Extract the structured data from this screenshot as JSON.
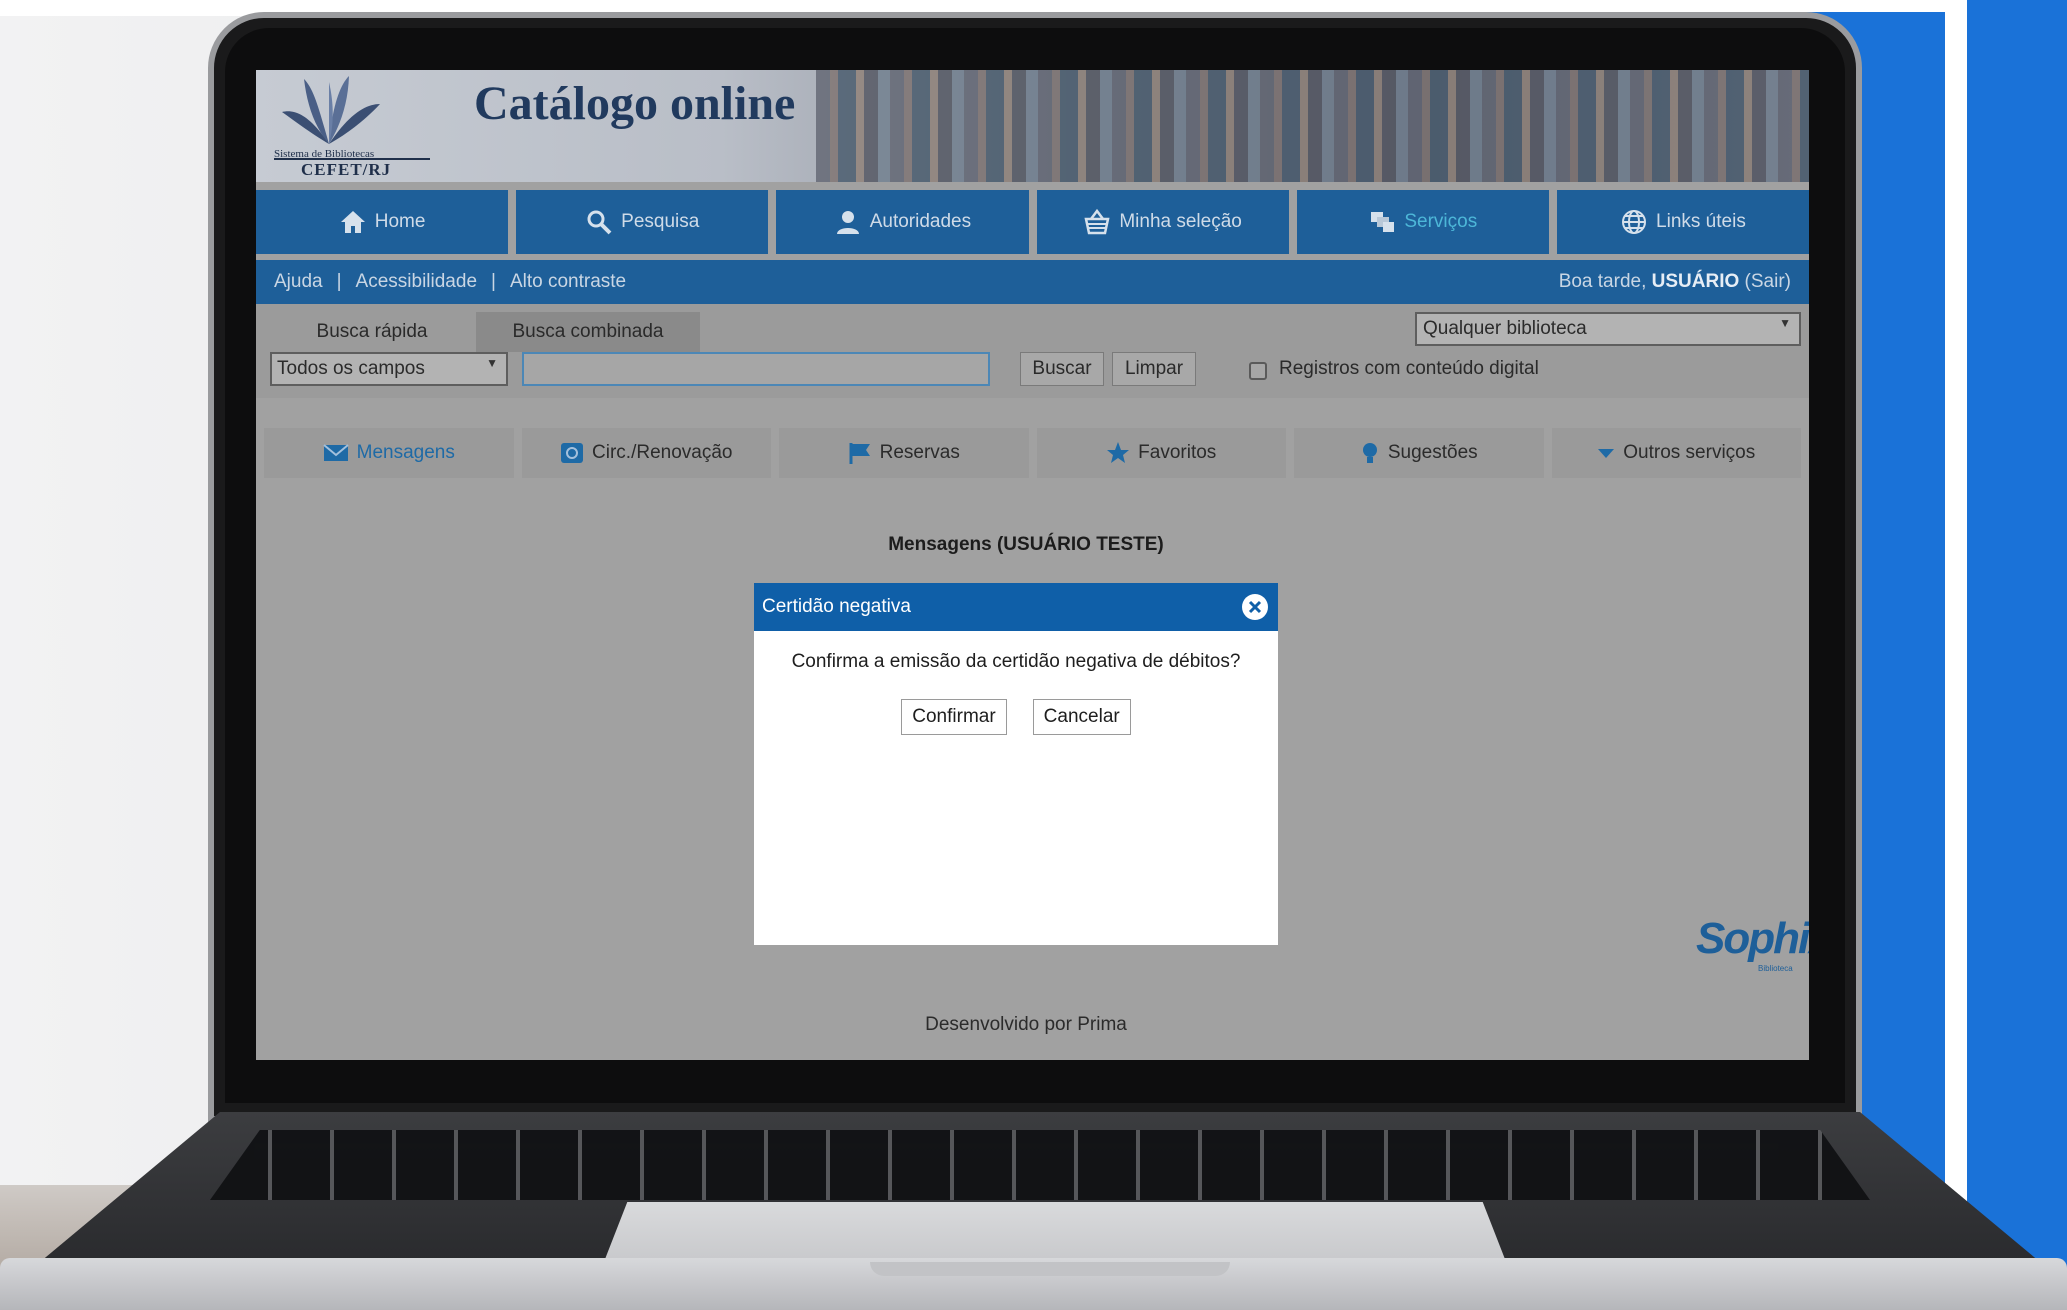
{
  "site": {
    "title": "Catálogo online",
    "logo_line1": "Sistema de Bibliotecas",
    "logo_line2": "CEFET/RJ"
  },
  "nav": [
    {
      "label": "Home",
      "icon": "home-icon"
    },
    {
      "label": "Pesquisa",
      "icon": "search-icon"
    },
    {
      "label": "Autoridades",
      "icon": "person-icon"
    },
    {
      "label": "Minha seleção",
      "icon": "basket-icon"
    },
    {
      "label": "Serviços",
      "icon": "services-icon",
      "active": true
    },
    {
      "label": "Links úteis",
      "icon": "globe-icon"
    }
  ],
  "subbar": {
    "help": "Ajuda",
    "accessibility": "Acessibilidade",
    "contrast": "Alto contraste",
    "greeting": "Boa tarde,",
    "user": "USUÁRIO",
    "logout": "(Sair)"
  },
  "search": {
    "tab_quick": "Busca rápida",
    "tab_combined": "Busca combinada",
    "library_select": "Qualquer biblioteca",
    "field_select": "Todos os campos",
    "input_value": "",
    "search_button": "Buscar",
    "clear_button": "Limpar",
    "digital_checkbox_label": "Registros com conteúdo digital",
    "digital_checked": false
  },
  "services": [
    {
      "label": "Mensagens",
      "icon": "envelope-icon",
      "active": true
    },
    {
      "label": "Circ./Renovação",
      "icon": "renew-icon"
    },
    {
      "label": "Reservas",
      "icon": "flag-icon"
    },
    {
      "label": "Favoritos",
      "icon": "star-icon"
    },
    {
      "label": "Sugestões",
      "icon": "lightbulb-icon"
    },
    {
      "label": "Outros serviços",
      "icon": "caret-down-icon"
    }
  ],
  "messages_title": "Mensagens (USUÁRIO TESTE)",
  "modal": {
    "title": "Certidão negativa",
    "text": "Confirma a emissão da certidão negativa de débitos?",
    "confirm": "Confirmar",
    "cancel": "Cancelar"
  },
  "brand": {
    "name": "SophiA",
    "sub": "Biblioteca"
  },
  "footer": "Desenvolvido por Prima",
  "colors": {
    "nav_blue": "#1e5f99",
    "modal_header": "#0f5fa8",
    "background_blue": "#1a72d8"
  }
}
